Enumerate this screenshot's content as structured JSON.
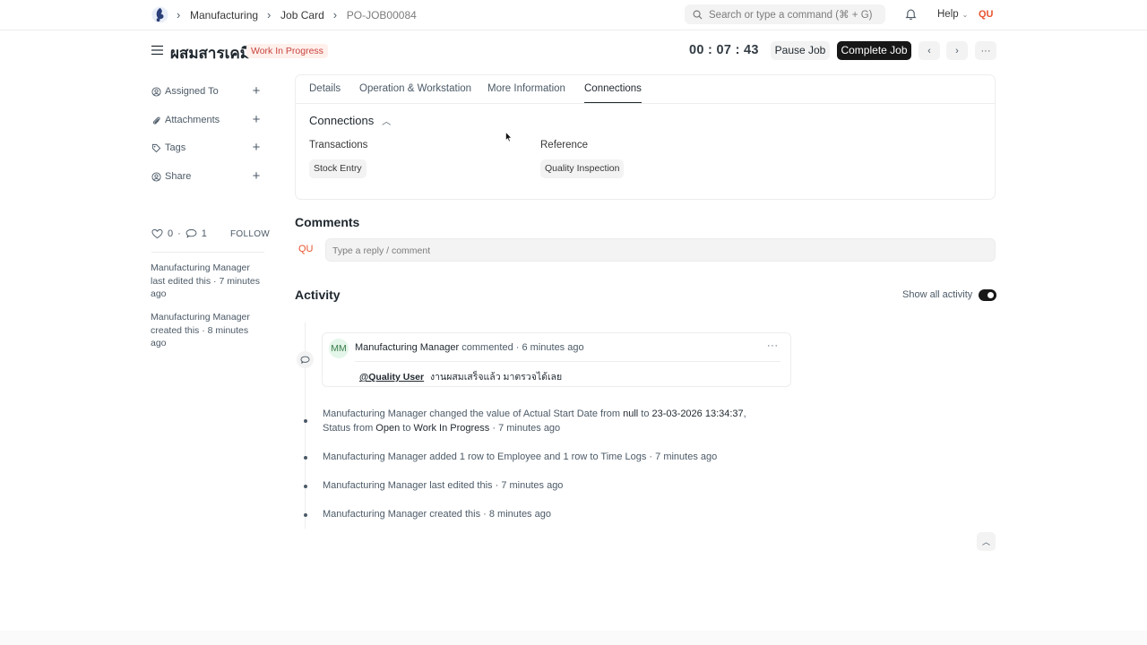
{
  "navbar": {
    "breadcrumbs": [
      "Manufacturing",
      "Job Card",
      "PO-JOB00084"
    ],
    "search_placeholder": "Search or type a command (⌘ + G)",
    "help_label": "Help",
    "user_initials": "QU",
    "icons": [
      "app-logo-icon",
      "search-icon",
      "bell-icon",
      "chevron-down-icon"
    ]
  },
  "header": {
    "title": "ผสมสารเคมี",
    "status": "Work In Progress",
    "timer": "00 : 07 : 43",
    "pause_label": "Pause Job",
    "complete_label": "Complete Job"
  },
  "sidebar": {
    "items": [
      {
        "label": "Assigned To",
        "icon": "assign-user-icon"
      },
      {
        "label": "Attachments",
        "icon": "paperclip-icon"
      },
      {
        "label": "Tags",
        "icon": "tag-icon"
      },
      {
        "label": "Share",
        "icon": "share-user-icon"
      }
    ],
    "likes": "0",
    "comments": "1",
    "follow_label": "FOLLOW",
    "log": [
      "Manufacturing Manager last edited this · 7 minutes ago",
      "Manufacturing Manager created this · 8 minutes ago"
    ]
  },
  "tabs": [
    "Details",
    "Operation & Workstation",
    "More Information",
    "Connections"
  ],
  "active_tab": "Connections",
  "connections": {
    "title": "Connections",
    "columns": [
      {
        "heading": "Transactions",
        "items": [
          "Stock Entry"
        ]
      },
      {
        "heading": "Reference",
        "items": [
          "Quality Inspection"
        ]
      }
    ]
  },
  "comments": {
    "title": "Comments",
    "user_initials": "QU",
    "placeholder": "Type a reply / comment"
  },
  "activity": {
    "title": "Activity",
    "show_all_label": "Show all activity",
    "show_all_on": true,
    "comment": {
      "avatar": "MM",
      "author": "Manufacturing Manager",
      "meta": "commented · 6 minutes ago",
      "mention": "@Quality User",
      "text": "งานผสมเสร็จแล้ว มาตรวจได้เลย"
    },
    "entries": [
      {
        "line1_pre": "Manufacturing Manager changed the value of Actual Start Date from ",
        "v1": "null",
        "mid1": " to ",
        "v2": "23-03-2026 13:34:37",
        "line1_post": ",",
        "line2_pre": "Status from ",
        "v3": "Open",
        "mid2": " to ",
        "v4": "Work In Progress",
        "line2_post": " · 7 minutes ago"
      },
      {
        "text": "Manufacturing Manager added 1 row to Employee and 1 row to Time Logs · 7 minutes ago"
      },
      {
        "text": "Manufacturing Manager last edited this · 7 minutes ago"
      },
      {
        "text": "Manufacturing Manager created this · 8 minutes ago"
      }
    ]
  }
}
